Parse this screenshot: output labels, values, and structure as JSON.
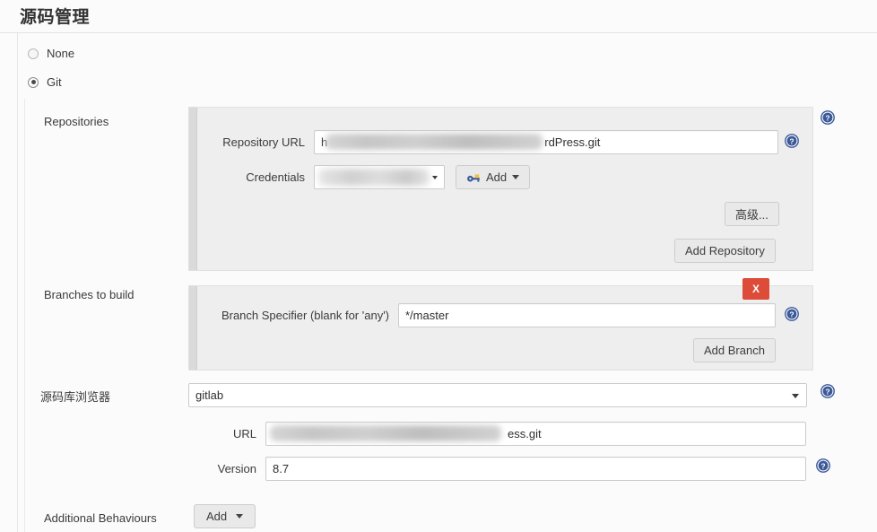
{
  "page": {
    "title": "源码管理"
  },
  "scm_options": [
    {
      "label": "None",
      "selected": false
    },
    {
      "label": "Git",
      "selected": true
    }
  ],
  "sections": {
    "repositories": {
      "label": "Repositories",
      "repository_url": {
        "label": "Repository URL",
        "value_prefix": "h",
        "value_suffix": "rdPress.git",
        "redacted": true
      },
      "credentials": {
        "label": "Credentials",
        "value": "",
        "redacted": true
      },
      "advanced_button": "高级...",
      "add_repository_button": "Add Repository",
      "add_credentials_button": "Add"
    },
    "branches": {
      "label": "Branches to build",
      "branch_specifier": {
        "label": "Branch Specifier (blank for 'any')",
        "value": "*/master"
      },
      "delete_button": "X",
      "add_branch_button": "Add Branch"
    },
    "repository_browser": {
      "label": "源码库浏览器",
      "selected": "gitlab",
      "url": {
        "label": "URL",
        "value_suffix": "ess.git",
        "redacted": true
      },
      "version": {
        "label": "Version",
        "value": "8.7"
      }
    },
    "additional_behaviours": {
      "label": "Additional Behaviours",
      "add_button": "Add"
    }
  },
  "colors": {
    "delete_red": "#dd4b39",
    "help_blue": "#3b5998",
    "panel_grey": "#eeeeee",
    "page_bg": "#fbfbfb"
  },
  "icons": {
    "help": "help-icon",
    "key": "key-icon",
    "caret": "chevron-down-icon"
  }
}
